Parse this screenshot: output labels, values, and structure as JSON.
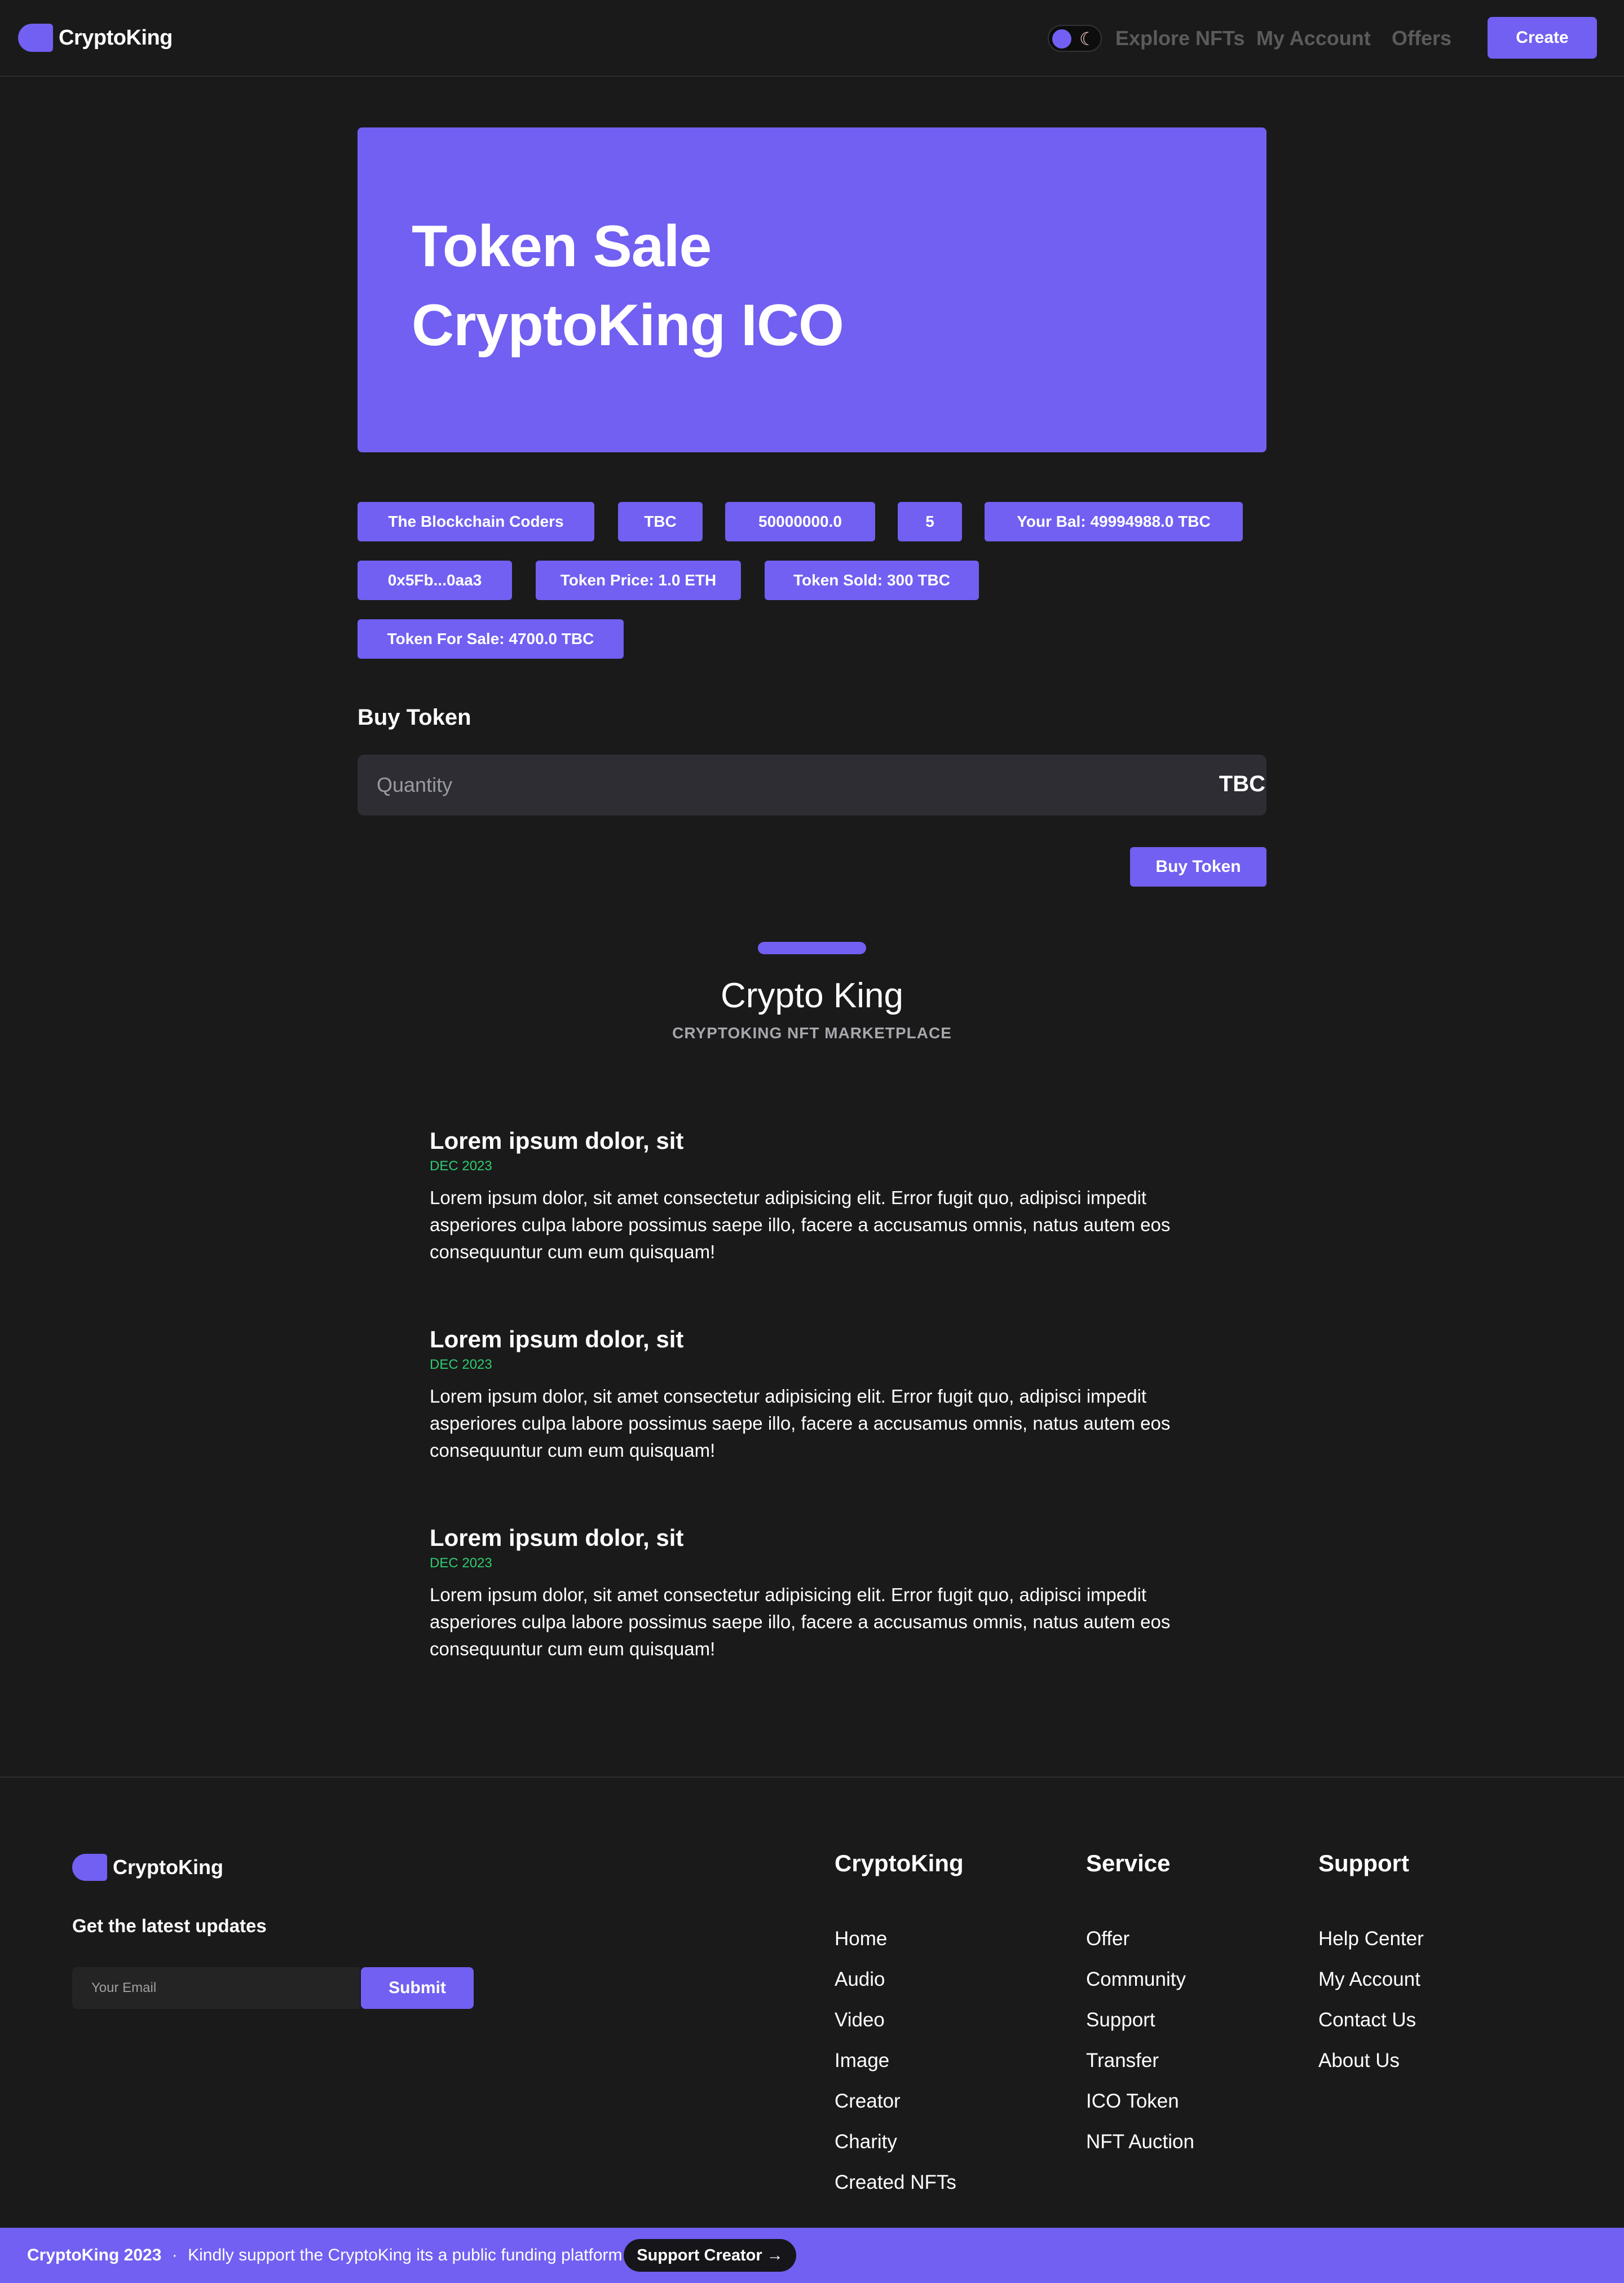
{
  "header": {
    "logo_text": "CryptoKing",
    "moon_icon": "☾",
    "nav": [
      "Explore NFTs",
      "My Account",
      "Offers"
    ],
    "create_label": "Create"
  },
  "hero": {
    "line1": "Token Sale",
    "line2": "CryptoKing ICO"
  },
  "token_info": {
    "owner": "The Blockchain Coders",
    "symbol": "TBC",
    "supply": "50000000.0",
    "count": "5",
    "balance": "Your Bal: 49994988.0 TBC",
    "address": "0x5Fb...0aa3",
    "price": "Token Price: 1.0 ETH",
    "sold": "Token Sold: 300 TBC",
    "for_sale": "Token For Sale: 4700.0 TBC"
  },
  "buy": {
    "title": "Buy Token",
    "placeholder": "Quantity",
    "unit": "TBC",
    "button": "Buy Token"
  },
  "section": {
    "title": "Crypto King",
    "subtitle": "CRYPTOKING NFT MARKETPLACE"
  },
  "posts": [
    {
      "title": "Lorem ipsum dolor, sit",
      "date": "DEC 2023",
      "body": "Lorem ipsum dolor, sit amet consectetur adipisicing elit. Error fugit quo, adipisci impedit asperiores culpa labore possimus saepe illo, facere a accusamus omnis, natus autem eos consequuntur cum eum quisquam!"
    },
    {
      "title": "Lorem ipsum dolor, sit",
      "date": "DEC 2023",
      "body": "Lorem ipsum dolor, sit amet consectetur adipisicing elit. Error fugit quo, adipisci impedit asperiores culpa labore possimus saepe illo, facere a accusamus omnis, natus autem eos consequuntur cum eum quisquam!"
    },
    {
      "title": "Lorem ipsum dolor, sit",
      "date": "DEC 2023",
      "body": "Lorem ipsum dolor, sit amet consectetur adipisicing elit. Error fugit quo, adipisci impedit asperiores culpa labore possimus saepe illo, facere a accusamus omnis, natus autem eos consequuntur cum eum quisquam!"
    }
  ],
  "footer": {
    "logo_text": "CryptoKing",
    "updates_label": "Get the latest updates",
    "email_placeholder": "Your Email",
    "submit_label": "Submit",
    "columns": [
      {
        "title": "CryptoKing",
        "links": [
          "Home",
          "Audio",
          "Video",
          "Image",
          "Creator",
          "Charity",
          "Created NFTs"
        ]
      },
      {
        "title": "Service",
        "links": [
          "Offer",
          "Community",
          "Support",
          "Transfer",
          "ICO Token",
          "NFT Auction"
        ]
      },
      {
        "title": "Support",
        "links": [
          "Help Center",
          "My Account",
          "Contact Us",
          "About Us"
        ]
      }
    ]
  },
  "banner": {
    "brand": "CryptoKing 2023",
    "separator": "·",
    "message": "Kindly support the CryptoKing its a public funding platform",
    "button": "Support Creator →"
  },
  "colors": {
    "accent": "#7160f1",
    "background": "#1a1a1a",
    "date_green": "#2ecc71"
  }
}
